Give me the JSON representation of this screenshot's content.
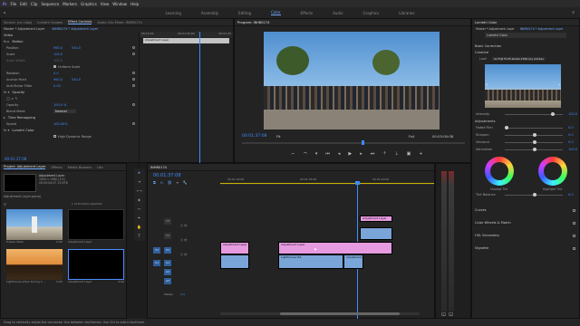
{
  "menu": [
    "Fr",
    "File",
    "Edit",
    "Clip",
    "Sequence",
    "Markers",
    "Graphics",
    "View",
    "Window",
    "Help"
  ],
  "workspaces": [
    "Learning",
    "Assembly",
    "Editing",
    "Color",
    "Effects",
    "Audio",
    "Graphics",
    "Libraries"
  ],
  "active_workspace": "Color",
  "effect_controls": {
    "tabs": [
      "Source: (no clips)",
      "Lumetri Scopes",
      "Effect Controls",
      "Audio Clip Mixer: INHB0174"
    ],
    "active_tab": "Effect Controls",
    "header_path": "Master * Adjustment Layer",
    "header_seq": "INHB0174 * Adjustment Layer",
    "video_label": "Video",
    "motion_label": "Motion",
    "props": [
      {
        "name": "Position",
        "value": "960.0",
        "value2": "540.0"
      },
      {
        "name": "Scale",
        "value": "100.0",
        "value2": ""
      },
      {
        "name": "Scale Width",
        "value": "100.0",
        "value2": ""
      },
      {
        "name": "Rotation",
        "value": "0.0",
        "value2": ""
      },
      {
        "name": "Anchor Point",
        "value": "960.0",
        "value2": "540.0"
      },
      {
        "name": "Anti-flicker Filter",
        "value": "0.00",
        "value2": ""
      }
    ],
    "uniform_scale": "Uniform Scale",
    "opacity_label": "Opacity",
    "opacity_value": "100.0 %",
    "blend_mode_label": "Blend Mode",
    "blend_mode_value": "Normal",
    "time_remap_label": "Time Remapping",
    "speed_label": "Speed",
    "speed_value": "100.00%",
    "lumetri_label": "Lumetri Color",
    "hdr_label": "High Dynamic Range",
    "mini_timecode": "00:01:37:08",
    "mini_times": [
      "00:15:00",
      "00:01:30:00",
      "00:01:45"
    ],
    "mini_clip": "Adjustment Layer"
  },
  "program": {
    "title": "Program: INHB0174",
    "timecode": "00:01:37:08",
    "fit": "Fit",
    "quality": "Full",
    "duration": "00:03:00:08"
  },
  "project": {
    "tabs": [
      "Project: Adjustment Layer",
      "Effects",
      "Media Browser",
      "Libr"
    ],
    "thumb_name": "Adjustment Layer",
    "thumb_info": [
      "Adjustment Layer",
      "1920 x 1080 (1.0)",
      "00:00:04:07 23.976"
    ],
    "project_file": "Adjustment Layer.prproj",
    "count": "1 of 10 items selected",
    "items": [
      {
        "name": "Freeze Video",
        "dur": "0:00"
      },
      {
        "name": "Adjustment Layer",
        "dur": ""
      },
      {
        "name": "Lighthouse Video During 1...",
        "dur": "0:00"
      },
      {
        "name": "Adjustment Layer",
        "dur": "5:00"
      }
    ]
  },
  "timeline": {
    "tab": "INHB0174",
    "timecode": "00:01:37:08",
    "ruler": [
      "00:01:30:00",
      "00:01:35:00",
      "00:01:40:00"
    ],
    "tracks": [
      "V3",
      "V2",
      "V1",
      "A1",
      "A2",
      "A3"
    ],
    "master_label": "Master",
    "master_value": "0.0",
    "clips": [
      {
        "name": "Adjustment Layer",
        "track": "V2"
      },
      {
        "name": "Adjustment Layer",
        "track": "V2b"
      },
      {
        "name": "Adjustment Layer",
        "track": "V3"
      },
      {
        "name": "Lighthouse Vid.",
        "track": "V1"
      },
      {
        "name": "Adjustment...",
        "track": "V1b"
      }
    ]
  },
  "lumetri": {
    "title": "Lumetri Color",
    "header_path": "Master * Adjustment Layer",
    "header_seq": "INHB0174 * Adjustment Layer",
    "source_label": "Lumetri Color",
    "basic_correction": "Basic Correction",
    "creative": "Creative",
    "look_label": "Look",
    "look_value": "SL FUJI F125 Kodak 2395 (by Adobe)",
    "intensity_label": "Intensity",
    "intensity_value": "100.0",
    "adjustments_label": "Adjustments",
    "adjust": [
      {
        "label": "Faded Film",
        "value": "0.0"
      },
      {
        "label": "Sharpen",
        "value": "0.0"
      },
      {
        "label": "Vibrance",
        "value": "0.0"
      },
      {
        "label": "Saturation",
        "value": "100.0"
      }
    ],
    "shadow_tint": "Shadow Tint",
    "highlight_tint": "Highlight Tint",
    "tint_balance_label": "Tint Balance",
    "tint_balance_value": "0.0",
    "sections": [
      "Curves",
      "Color Wheels & Match",
      "HSL Secondary",
      "Vignette"
    ]
  },
  "status_text": "Drag to vertically adjust the connector line between keyframes. Use Ctrl to add a keyframe."
}
